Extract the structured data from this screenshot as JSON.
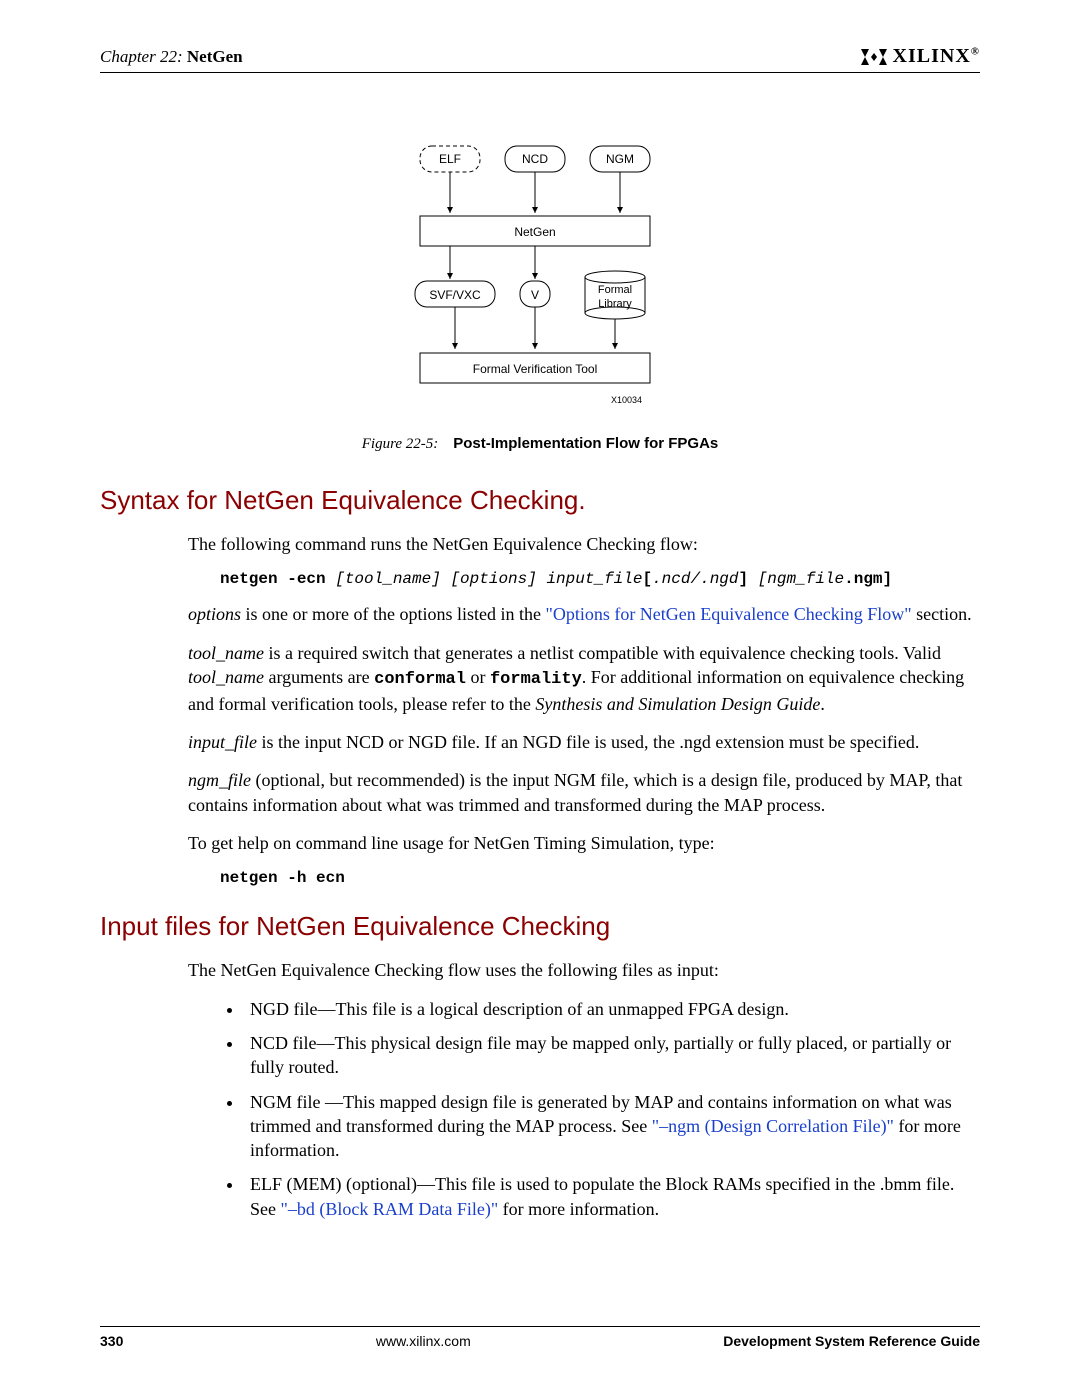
{
  "header": {
    "chapter_prefix": "Chapter 22:",
    "chapter_title": "NetGen",
    "logo_text": "XILINX",
    "logo_reg": "®"
  },
  "diagram": {
    "elf": "ELF",
    "ncd": "NCD",
    "ngm": "NGM",
    "netgen": "NetGen",
    "svf": "SVF/VXC",
    "v": "V",
    "formal_lib1": "Formal",
    "formal_lib2": "Library",
    "tool": "Formal Verification Tool",
    "ref": "X10034"
  },
  "figure_caption": {
    "label": "Figure 22-5:",
    "title": "Post-Implementation Flow for FPGAs"
  },
  "section1": {
    "heading": "Syntax for NetGen Equivalence Checking.",
    "intro": "The following command runs the NetGen Equivalence Checking flow:",
    "cmd_prefix": "netgen -ecn ",
    "cmd_tool": "[tool_name] [options] input_file",
    "cmd_ext": "[.ncd/.ngd",
    "cmd_close": "] ",
    "cmd_ngm1": "[ngm_file",
    "cmd_ngm2": ".ngm",
    "cmd_ngm3": "]",
    "options_para_pre": "options",
    "options_para_mid": " is one or more of the options listed in the ",
    "options_link": "\"Options for NetGen Equivalence Checking Flow\"",
    "options_para_post": " section.",
    "toolname_para_1": "tool_name",
    "toolname_para_2": " is a required switch that generates a netlist compatible with equivalence checking tools. Valid ",
    "toolname_para_3": "tool_name",
    "toolname_para_4": " arguments are ",
    "toolname_conformal": "conformal",
    "toolname_or": " or ",
    "toolname_formality": "formality",
    "toolname_para_5": ". For additional information on equivalence checking and formal verification tools, please refer to the ",
    "toolname_guide": "Synthesis and Simulation Design Guide",
    "toolname_period": ".",
    "inputfile_para_1": "input_file",
    "inputfile_para_2": " is the input NCD or NGD file. If an NGD file is used, the .ngd extension must be specified.",
    "ngmfile_para_1": "ngm_file",
    "ngmfile_para_2": " (optional, but recommended) is the input NGM file, which is a design file, produced by MAP, that contains information about what was trimmed and transformed during the MAP process.",
    "help_intro": "To get help on command line usage for NetGen Timing Simulation, type:",
    "help_cmd": "netgen -h ecn"
  },
  "section2": {
    "heading": "Input files for NetGen Equivalence Checking",
    "intro": "The NetGen Equivalence Checking flow uses the following files as input:",
    "bullets": [
      {
        "pre": "NGD file—This file is a logical description of an unmapped FPGA design.",
        "link": "",
        "post": ""
      },
      {
        "pre": "NCD file—This physical design file may be mapped only, partially or fully placed, or partially or fully routed.",
        "link": "",
        "post": ""
      },
      {
        "pre": "NGM file —This mapped design file is generated by MAP and contains information on what was trimmed and transformed during the MAP process. See ",
        "link": "\"–ngm (Design Correlation File)\"",
        "post": " for more information."
      },
      {
        "pre": "ELF (MEM) (optional)—This file is used to populate the Block RAMs specified in the .bmm file. See ",
        "link": "\"–bd (Block RAM Data File)\"",
        "post": " for more information."
      }
    ]
  },
  "footer": {
    "page": "330",
    "url": "www.xilinx.com",
    "doc": "Development System Reference Guide"
  }
}
